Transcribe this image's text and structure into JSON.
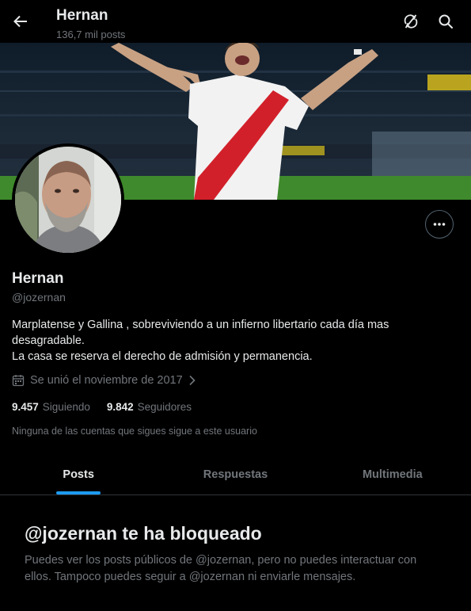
{
  "header": {
    "name": "Hernan",
    "post_count": "136,7 mil posts"
  },
  "icons": {
    "back": "arrow-left-icon",
    "refresh": "refresh-icon",
    "search": "search-icon",
    "more": "more-horizontal-icon",
    "calendar": "calendar-icon",
    "chevron": "chevron-right-icon"
  },
  "profile": {
    "name": "Hernan",
    "handle": "@jozernan",
    "bio_lines": [
      "Marplatense y Gallina , sobreviviendo a un infierno libertario cada día mas",
      "desagradable.",
      "La casa se reserva el derecho de admisión y permanencia."
    ],
    "joined": "Se unió el noviembre de 2017",
    "following_count": "9.457",
    "following_label": "Siguiendo",
    "followers_count": "9.842",
    "followers_label": "Seguidores",
    "no_mutuals": "Ninguna de las cuentas que sigues sigue a este usuario"
  },
  "tabs": [
    {
      "label": "Posts",
      "active": true
    },
    {
      "label": "Respuestas",
      "active": false
    },
    {
      "label": "Multimedia",
      "active": false
    }
  ],
  "blocked": {
    "title": "@jozernan te ha bloqueado",
    "text": "Puedes ver los posts públicos de @jozernan, pero no puedes interactuar con ellos. Tampoco puedes seguir a @jozernan ni enviarle mensajes."
  },
  "colors": {
    "background": "#000000",
    "text_primary": "#e7e9ea",
    "text_secondary": "#71767b",
    "accent": "#1d9bf0",
    "border": "#2f3336"
  }
}
